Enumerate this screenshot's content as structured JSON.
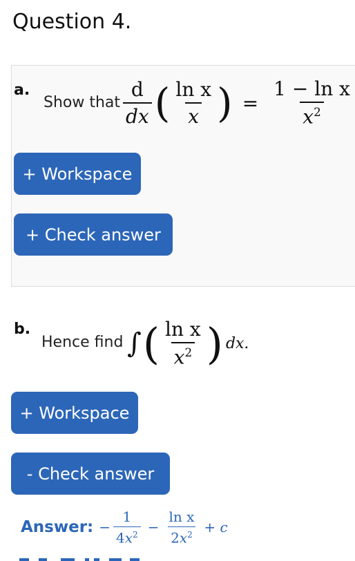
{
  "question": {
    "title": "Question 4."
  },
  "part_a": {
    "label": "a.",
    "prompt": "Show that",
    "math": {
      "d": "d",
      "dx": "dx",
      "ln_x": "ln x",
      "x": "x",
      "equals": "=",
      "rhs_num": "1 − ln x",
      "rhs_den_base": "x",
      "rhs_den_exp": "2"
    },
    "workspace_button": "+ Workspace",
    "check_button": "+ Check answer"
  },
  "part_b": {
    "label": "b.",
    "prompt": "Hence find",
    "math": {
      "integral": "∫",
      "num": "ln x",
      "den_base": "x",
      "den_exp": "2",
      "dx": "dx."
    },
    "workspace_button": "+ Workspace",
    "check_button": "- Check answer",
    "answer": {
      "label": "Answer:",
      "minus1": "−",
      "t1_num": "1",
      "t1_den_coef": "4",
      "t1_den_base": "x",
      "t1_den_exp": "2",
      "minus2": "−",
      "t2_num": "ln x",
      "t2_den_coef": "2",
      "t2_den_base": "x",
      "t2_den_exp": "2",
      "plus_c": "+ c"
    }
  },
  "colors": {
    "button_bg": "#2c66b8",
    "answer_text": "#2c66b8",
    "panel_bg": "#f9f9f9"
  }
}
